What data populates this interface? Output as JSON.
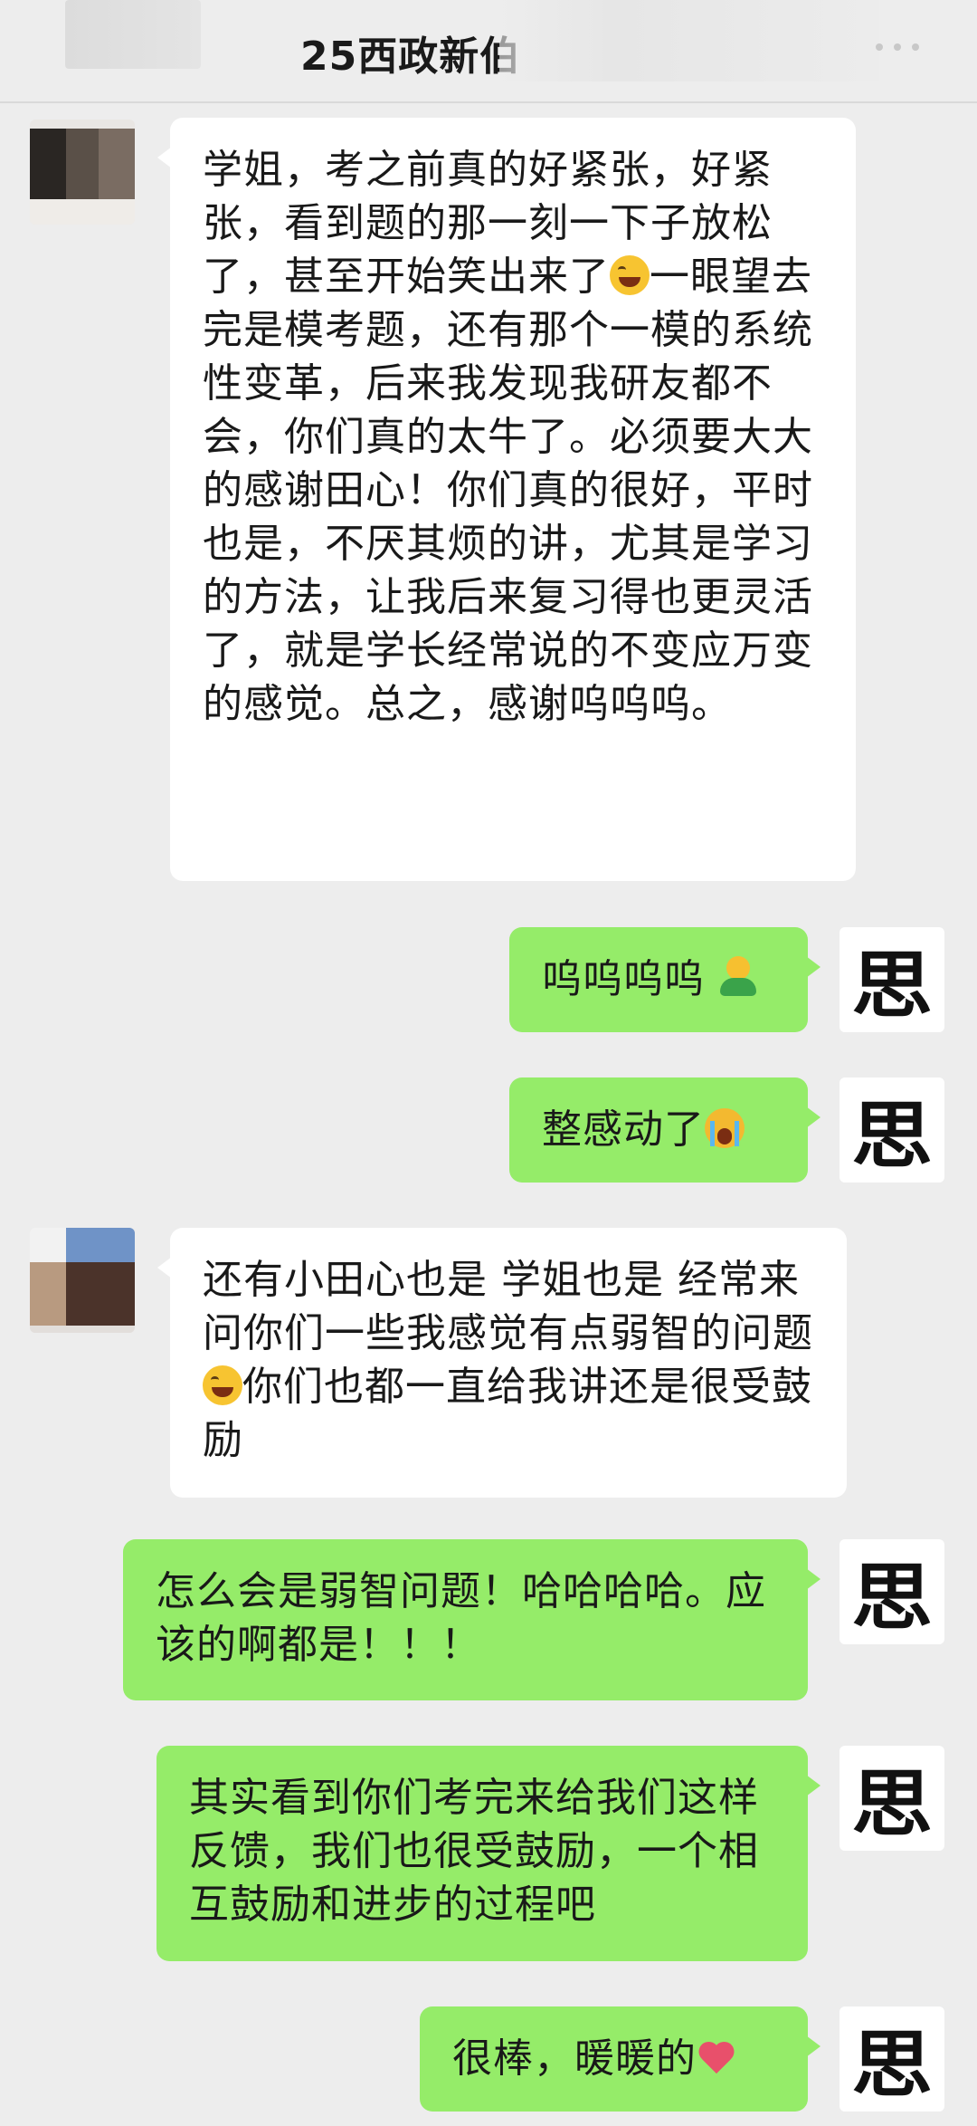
{
  "header": {
    "title": "25西政新伯"
  },
  "avatars": {
    "right_glyph": "思"
  },
  "messages": [
    {
      "side": "left",
      "text": "学姐，考之前真的好紧张，好紧张，看到题的那一刻一下子放松了，甚至开始笑出来了",
      "emoji": "face-with-tears-of-joy",
      "text2": "一眼望去完是模考题，还有那个一模的系统性变革，后来我发现我研友都不会，你们真的太牛了。必须要大大的感谢田心！你们真的很好，平时也是，不厌其烦的讲，尤其是学习的方法，让我后来复习得也更灵活了，就是学长经常说的不变应万变的感觉。总之，感谢呜呜呜。"
    },
    {
      "side": "right",
      "text": "呜呜呜呜",
      "emoji": "person-figure"
    },
    {
      "side": "right",
      "text": "整感动了",
      "emoji": "loudly-crying-face"
    },
    {
      "side": "left",
      "text": "还有小田心也是 学姐也是 经常来问你们一些我感觉有点弱智的问题",
      "emoji": "face-with-tears-of-joy",
      "text2": "你们也都一直给我讲还是很受鼓励"
    },
    {
      "side": "right",
      "text": "怎么会是弱智问题！哈哈哈哈。应该的啊都是！！！"
    },
    {
      "side": "right",
      "text": "其实看到你们考完来给我们这样反馈，我们也很受鼓励，一个相互鼓励和进步的过程吧"
    },
    {
      "side": "right",
      "text": "很棒，暖暖的",
      "emoji": "red-heart"
    }
  ]
}
